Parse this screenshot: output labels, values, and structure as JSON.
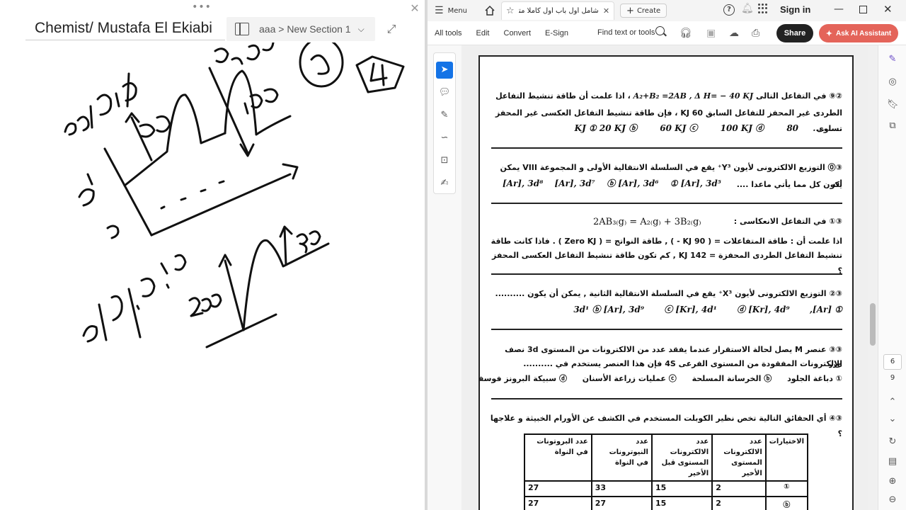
{
  "onenote": {
    "page_title": "Chemist/ Mustafa El Ekiabi",
    "section_path": "aaa > New Section 1",
    "dots": "•••",
    "close": "✕",
    "expand": "⤢",
    "chevron": "⌵"
  },
  "acrobat": {
    "menu_label": "Menu",
    "doc_tab_title": "شامل أول باب أول كاملا متدرج....",
    "create_label": "Create",
    "help": "?",
    "sign_in": "Sign in",
    "tools": [
      "All tools",
      "Edit",
      "Convert",
      "E-Sign"
    ],
    "find_label": "Find text or tools",
    "share_label": "Share",
    "ask_ai_label": "Ask AI Assistant",
    "page_current": "6",
    "page_total": "9"
  },
  "pdf": {
    "q29_line1": "في التفاعل التالى",
    "q29_eq": "A₂+B₂ =2AB , Δ H= − 40 KJ",
    "q29_line1b": "، اذا علمت أن طاقة تنشيط التفاعل",
    "q29_line2": "الطردى غير المحفز للتفاعل السابق 60 KJ ، فإن طاقة تنشيط التفاعل العكسى غير المحفز تساوى",
    "q29_dots": "..........",
    "q29_opts": [
      "80 KJ ①",
      "20 KJ ⓑ",
      "60 KJ ⓒ",
      "100 KJ ⓓ"
    ],
    "q29_num": "②⑨",
    "q30_num": "③⓪",
    "q30_line1": "التوزيع الالكترونى لأيون Y³⁺ يقع في السلسلة الانتقالية الأولى و المجموعة VIII يمكن ان",
    "q30_line2": "يكون كل مما يأتي ماعدا ....",
    "q30_opts": [
      "① [Ar], 3d⁵",
      "ⓑ [Ar], 3d⁶",
      "[Ar], 3d⁷",
      "[Ar], 3d⁸"
    ],
    "q31_num": "③①",
    "q31_line1": "في التفاعل الانعكاسى :",
    "q31_eq": "2AB₃₍g₎  =  A₂₍g₎ + 3B₂₍g₎",
    "q31_line2": "اذا علمت أن : طاقة المتفاعلات = ( 90 KJ - ) , طاقة النواتج = ( Zero KJ ) . فاذا كانت طاقة",
    "q31_line3": "تنشيط التفاعل الطردى المحفزة = 142 KJ , كم تكون طاقة تنشيط التفاعل العكسى المحفز ؟",
    "q32_num": "③②",
    "q32_line1": "التوزيع الالكترونى لأيون X³⁺ يقع في السلسلة الانتقالية الثانية , يمكن أن يكون ..........",
    "q32_opts": [
      "① [Ar], 3d¹",
      "ⓑ [Ar], 3d⁹",
      "ⓒ [Kr], 4d¹",
      "ⓓ [Kr], 4d⁹"
    ],
    "q33_num": "③③",
    "q33_line1": "عنصر M يصل لحالة الاستقرار عندما يفقد عدد من الالكترونات من المستوى 3d نصف عدد",
    "q33_line2": "الالكترونات المفقودة من المستوى الفرعى 4S فإن هذا العنصر يستخدم في ..........",
    "q33_opts": [
      "① دباغة الجلود",
      "ⓑ الخرسانة المسلحة",
      "ⓒ عمليات زراعة الأسنان",
      "ⓓ سبيكة البرونز فوسفور"
    ],
    "q34_num": "③④",
    "q34_line1": "أي الحقائق التالية تخص نظير الكوبلت المستخدم في الكشف عن الأورام الخبيثة و علاجها ؟",
    "table_headers": [
      "الاختيارات",
      "عدد الالكترونات المستوى الأخير",
      "عدد الالكترونات المستوى قبل الأخير",
      "عدد النيوترونات في النواة",
      "عدد البروتونات في النواة"
    ],
    "table_rows": [
      [
        "①",
        "2",
        "15",
        "33",
        "27"
      ],
      [
        "ⓑ",
        "2",
        "15",
        "27",
        "27"
      ]
    ]
  }
}
